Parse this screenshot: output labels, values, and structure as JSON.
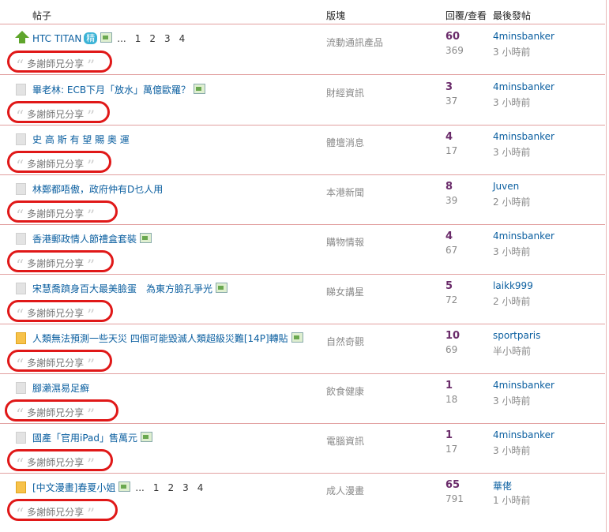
{
  "header": {
    "col_post": "帖子",
    "col_forum": "版塊",
    "col_replies": "回覆/查看",
    "col_last": "最後發帖"
  },
  "share_text": "多謝師兄分享",
  "rows": [
    {
      "title": "HTC TITAN",
      "badge": "精",
      "pages": [
        "...",
        "1",
        "2",
        "3",
        "4"
      ],
      "forum": "流動通訊產品",
      "replies": "60",
      "views": "369",
      "last_by": "4minsbanker",
      "last_time": "3 小時前",
      "icon": "arrow-up"
    },
    {
      "title": "畢老林: ECB下月「放水」萬億歐羅？",
      "forum": "財經資訊",
      "replies": "3",
      "views": "37",
      "last_by": "4minsbanker",
      "last_time": "3 小時前",
      "icon": "doc"
    },
    {
      "title": "史 高 斯 有 望 賜 奧 運",
      "forum": "體壇消息",
      "replies": "4",
      "views": "17",
      "last_by": "4minsbanker",
      "last_time": "3 小時前",
      "icon": "doc"
    },
    {
      "title": "林鄭都唔傲，政府仲有D乜人用",
      "forum": "本港新聞",
      "replies": "8",
      "views": "39",
      "last_by": "Juven",
      "last_time": "2 小時前",
      "icon": "doc"
    },
    {
      "title": "香港郵政情人節禮盒套裝",
      "forum": "購物情報",
      "replies": "4",
      "views": "67",
      "last_by": "4minsbanker",
      "last_time": "3 小時前",
      "icon": "doc"
    },
    {
      "title": "宋慧喬躋身百大最美臉蛋　為東方臉孔爭光",
      "forum": "睇女講星",
      "replies": "5",
      "views": "72",
      "last_by": "laikk999",
      "last_time": "2 小時前",
      "icon": "doc"
    },
    {
      "title": "人類無法預測一些天災 四個可能毀滅人類超級災難[14P]轉貼",
      "forum": "自然奇觀",
      "replies": "10",
      "views": "69",
      "last_by": "sportparis",
      "last_time": "半小時前",
      "icon": "folder"
    },
    {
      "title": "腳瀨濕易足癬",
      "forum": "飲食健康",
      "replies": "1",
      "views": "18",
      "last_by": "4minsbanker",
      "last_time": "3 小時前",
      "icon": "doc"
    },
    {
      "title": "國產「官用iPad」售萬元",
      "forum": "電腦資訊",
      "replies": "1",
      "views": "17",
      "last_by": "4minsbanker",
      "last_time": "3 小時前",
      "icon": "doc"
    },
    {
      "title": "[中文漫畫]春夏小姐",
      "pages": [
        "...",
        "1",
        "2",
        "3",
        "4"
      ],
      "forum": "成人漫畫",
      "replies": "65",
      "views": "791",
      "last_by": "華佬",
      "last_time": "1 小時前",
      "icon": "folder"
    }
  ],
  "colors": {
    "border": "#e2a0a0",
    "link": "#0b5fa0",
    "replies": "#6a2b6a",
    "ring": "#e01818"
  }
}
